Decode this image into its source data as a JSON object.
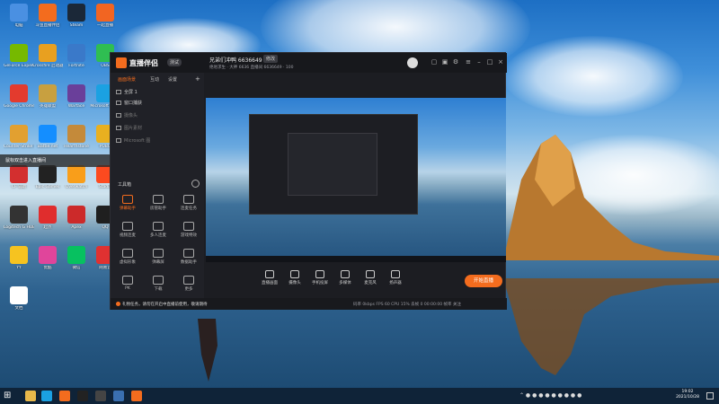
{
  "popup": {
    "text": "鼠标双击进入直播间"
  },
  "desktop_icons": [
    {
      "label": "电脑",
      "color": "#4a90e2"
    },
    {
      "label": "斗鱼直播伴侣",
      "color": "#f36c1e"
    },
    {
      "label": "Steam",
      "color": "#1b2838"
    },
    {
      "label": "一起直播",
      "color": "#f26522"
    },
    {
      "label": "GeForce Experience",
      "color": "#76b900"
    },
    {
      "label": "Crossfire 启动器",
      "color": "#e8a020"
    },
    {
      "label": "Fortnite",
      "color": "#3a79c9"
    },
    {
      "label": "OBS",
      "color": "#2fbe52"
    },
    {
      "label": "Google Chrome",
      "color": "#e33b2e"
    },
    {
      "label": "英雄联盟",
      "color": "#c8a040"
    },
    {
      "label": "Warface",
      "color": "#6a3f9a"
    },
    {
      "label": "Microsoft Edge",
      "color": "#1ba1e2"
    },
    {
      "label": "Counter-Strike GO",
      "color": "#e2a030"
    },
    {
      "label": "Battle.net",
      "color": "#148eff"
    },
    {
      "label": "Hearthstone",
      "color": "#c48a3a"
    },
    {
      "label": "PUBG",
      "color": "#e8b020"
    },
    {
      "label": "CF 辅助",
      "color": "#d32f2f"
    },
    {
      "label": "Epic Games",
      "color": "#222"
    },
    {
      "label": "Overwatch",
      "color": "#f99e1a"
    },
    {
      "label": "Stadia",
      "color": "#fc4a1f"
    },
    {
      "label": "Logitech G HUB",
      "color": "#333"
    },
    {
      "label": "起点",
      "color": "#e02d2d"
    },
    {
      "label": "Apex",
      "color": "#cc2a2a"
    },
    {
      "label": "QQ",
      "color": "#1f1f1f"
    },
    {
      "label": "YY",
      "color": "#f6c320"
    },
    {
      "label": "优酷",
      "color": "#e0459b"
    },
    {
      "label": "微信",
      "color": "#07c160"
    },
    {
      "label": "网易云",
      "color": "#e03131"
    },
    {
      "label": "文档",
      "color": "#ffffff"
    }
  ],
  "app": {
    "name": "直播伴侣",
    "version": "测试",
    "room_title": "兄弟们冲鸭 6636649",
    "edit_label": "修改",
    "room_meta": "绝地求生 · 大神   6636   直播间  6636649  · 100",
    "tabs": [
      "画面场景",
      "互动",
      "设置"
    ],
    "scenes": [
      "全屏 1",
      "窗口捕获",
      "摄像头",
      "图片素材",
      "Microsoft 图"
    ],
    "toolbox_title": "工具箱",
    "tools": [
      {
        "label": "弹幕助手",
        "hot": true
      },
      {
        "label": "房管助手",
        "hot": false
      },
      {
        "label": "连麦任务",
        "hot": false
      },
      {
        "label": "视频连麦",
        "hot": false
      },
      {
        "label": "多人连麦",
        "hot": false
      },
      {
        "label": "游戏特效",
        "hot": false
      },
      {
        "label": "虚拟形象",
        "hot": false
      },
      {
        "label": "弹幕屏",
        "hot": false
      },
      {
        "label": "数据助手",
        "hot": false
      },
      {
        "label": "PK",
        "hot": false
      },
      {
        "label": "下载",
        "hot": false
      },
      {
        "label": "更多",
        "hot": false
      }
    ],
    "controls": [
      "直播画面",
      "摄像头",
      "手机投屏",
      "多媒体",
      "麦克风",
      "扬声器"
    ],
    "start_button": "开始直播",
    "status_warn": "礼物任务，请勿在开启中直播前使用，敬请期待",
    "status_stats": "码率 0kbps   FPS 60   CPU 15%   丢帧 0   00:00:00   帧率   关注"
  },
  "taskbar": {
    "time": "19:02",
    "date": "2021/10/28"
  },
  "colors": {
    "accent": "#f36c1e",
    "window_bg": "#1c1d22"
  }
}
